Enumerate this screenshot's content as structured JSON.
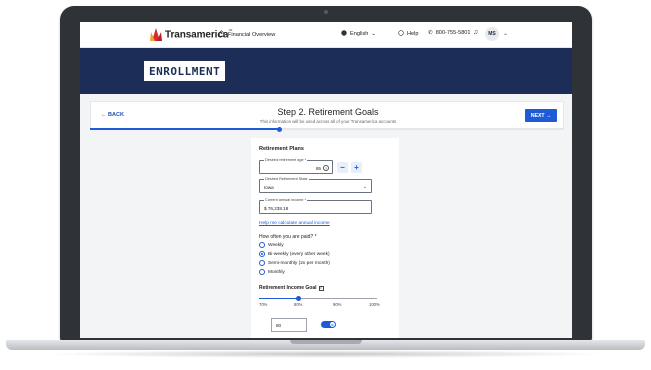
{
  "brand": {
    "name": "Transamerica",
    "mark": "℠"
  },
  "nav": {
    "financial_overview": "Financial Overview",
    "language": "English",
    "help": "Help",
    "phone": "800-755-5801",
    "avatar_initials": "MS"
  },
  "hero": {
    "title": "ENROLLMENT"
  },
  "step": {
    "back_label": "← BACK",
    "title": "Step 2. Retirement Goals",
    "subtitle": "This information will be used across all of your Transamerica accounts",
    "next_label": "NEXT →",
    "progress": 0.4
  },
  "form": {
    "section_title": "Retirement Plans",
    "retirement_age": {
      "label": "Desired retirement age *",
      "value": "65"
    },
    "state": {
      "label": "Desired Retirement State",
      "value": "Iowa"
    },
    "income": {
      "label": "Current annual income *",
      "value": "$ 76,238.18"
    },
    "calc_link": "Help me calculate annual income",
    "pay_question": "How often you are paid? *",
    "pay_options": [
      "Weekly",
      "Bi-weekly (every other week)",
      "Semi-monthly (2x per month)",
      "Monthly"
    ],
    "pay_selected": 1,
    "goal_title": "Retirement Income Goal",
    "goal_ticks": [
      "70%",
      "80%",
      "90%",
      "100%"
    ],
    "goal_value": 80,
    "goal_range": [
      70,
      100
    ],
    "goal_input": "80",
    "toggle_label": "%",
    "toggle_on": true
  },
  "colors": {
    "navy": "#1c2e58",
    "accent": "#1f5bd6",
    "brand_red": "#d62b2b"
  }
}
